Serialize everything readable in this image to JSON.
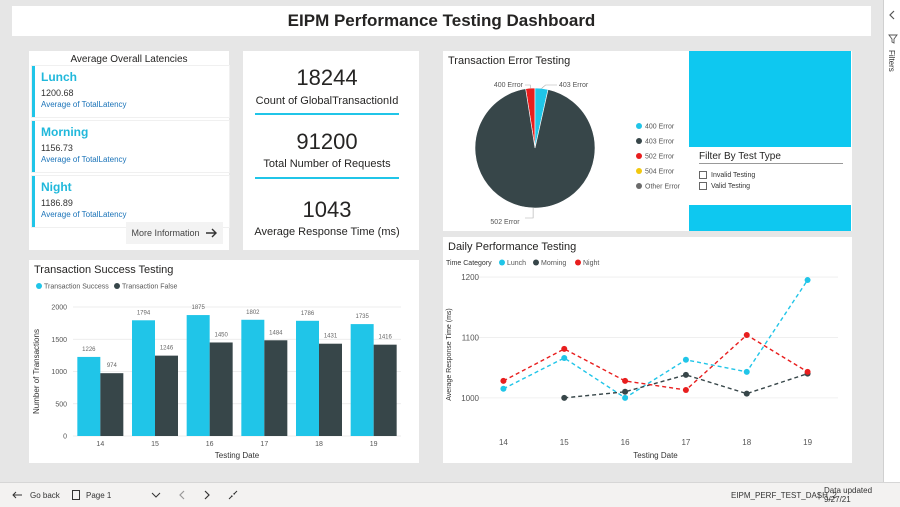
{
  "dashboard": {
    "title": "EIPM Performance Testing Dashboard"
  },
  "latencies": {
    "title": "Average Overall Latencies",
    "items": [
      {
        "name": "Lunch",
        "value": "1200.68",
        "sub": "Average of TotalLatency"
      },
      {
        "name": "Morning",
        "value": "1156.73",
        "sub": "Average of TotalLatency"
      },
      {
        "name": "Night",
        "value": "1186.89",
        "sub": "Average of TotalLatency"
      }
    ],
    "more_label": "More Information",
    "more_icon": "arrow-right-icon"
  },
  "kpis": [
    {
      "value": "18244",
      "label": "Count of GlobalTransactionId"
    },
    {
      "value": "91200",
      "label": "Total Number of Requests"
    },
    {
      "value": "1043",
      "label": "Average Response Time (ms)"
    }
  ],
  "error_card": {
    "filter_title": "Filter By Test Type",
    "filter_options": [
      "Invalid Testing",
      "Valid Testing"
    ]
  },
  "status_bar": {
    "back_label": "Go back",
    "page_label": "Page 1",
    "report_name": "EIPM_PERF_TEST_DASH_2",
    "separator": "|",
    "updated": "Data updated 9/27/21"
  },
  "right_pane": {
    "filters_label": "Filters"
  },
  "colors": {
    "cyan": "#20c5e8",
    "dark": "#374649",
    "red": "#e81e1e",
    "yellow": "#f2c80f",
    "grey": "#6b6b6b"
  },
  "chart_data": [
    {
      "type": "pie",
      "title": "Transaction Error Testing",
      "labels": [
        "400 Error",
        "403 Error",
        "502 Error",
        "504 Error",
        "Other Error"
      ],
      "values": [
        3.5,
        94.0,
        2.5,
        0,
        0
      ],
      "slice_labels": [
        "400 Error",
        "403 Error",
        "502 Error"
      ],
      "legend_position": "right"
    },
    {
      "type": "bar",
      "title": "Transaction Success Testing",
      "xlabel": "Testing Date",
      "ylabel": "Number of Transactions",
      "categories": [
        "14",
        "15",
        "16",
        "17",
        "18",
        "19"
      ],
      "series": [
        {
          "name": "Transaction Success",
          "values": [
            1226,
            1794,
            1875,
            1802,
            1786,
            1735
          ]
        },
        {
          "name": "Transaction False",
          "values": [
            974,
            1246,
            1450,
            1484,
            1431,
            1416
          ]
        }
      ],
      "ylim": [
        0,
        2000
      ],
      "yticks": [
        "0",
        "500",
        "1000",
        "1500",
        "2000"
      ],
      "legend_position": "top-left"
    },
    {
      "type": "line",
      "title": "Daily Performance Testing",
      "xlabel": "Testing Date",
      "ylabel": "Average Response Time (ms)",
      "legend_title": "Time Category",
      "x": [
        "14",
        "15",
        "16",
        "17",
        "18",
        "19"
      ],
      "series": [
        {
          "name": "Lunch",
          "values": [
            1015,
            1066,
            1000,
            1063,
            1043,
            1195
          ]
        },
        {
          "name": "Morning",
          "values": [
            null,
            1000,
            1010,
            1038,
            1007,
            1040
          ]
        },
        {
          "name": "Night",
          "values": [
            1028,
            1081,
            1028,
            1013,
            1104,
            1043
          ]
        }
      ],
      "ylim": [
        960,
        1210
      ],
      "yticks": [
        "1000",
        "1100",
        "1200"
      ],
      "legend_position": "top-left"
    }
  ]
}
